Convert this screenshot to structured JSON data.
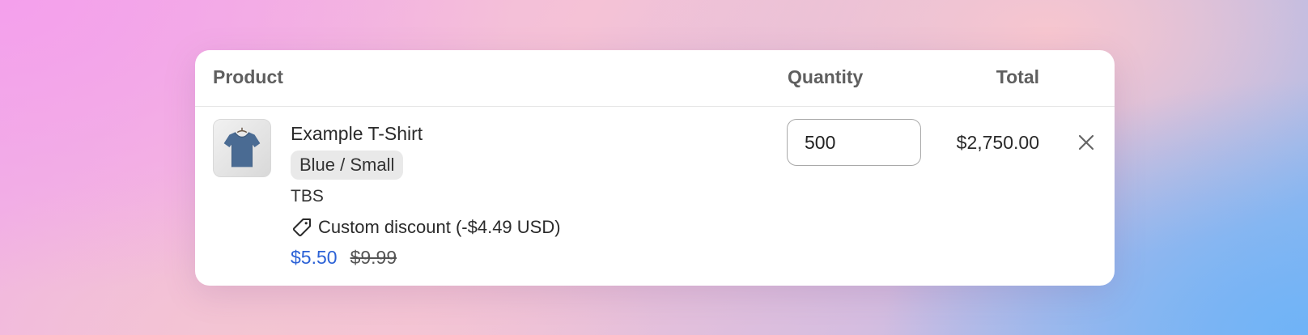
{
  "table": {
    "headers": {
      "product": "Product",
      "quantity": "Quantity",
      "total": "Total"
    },
    "rows": [
      {
        "image_icon": "tshirt-thumbnail",
        "name": "Example T-Shirt",
        "variant": "Blue / Small",
        "sku": "TBS",
        "discount_icon": "tag-icon",
        "discount": "Custom discount (-$4.49 USD)",
        "price": "$5.50",
        "compare_at_price": "$9.99",
        "quantity": "500",
        "total": "$2,750.00",
        "remove_icon": "close-icon"
      }
    ]
  },
  "colors": {
    "accent_price": "#2c62d6",
    "card_bg": "#ffffff",
    "badge_bg": "#e9e9e9",
    "tshirt": "#4a6b93"
  }
}
